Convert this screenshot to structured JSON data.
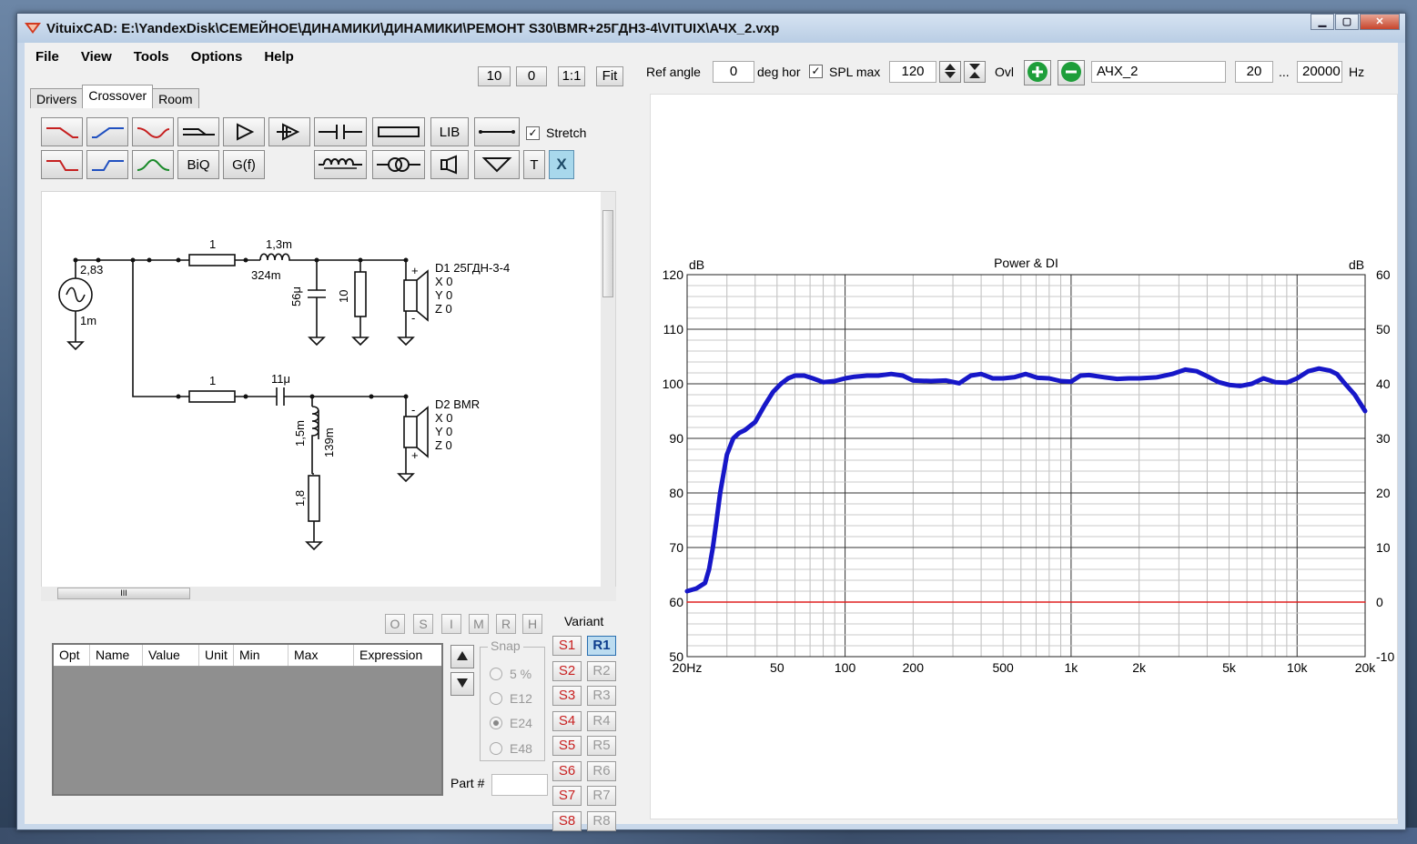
{
  "window": {
    "title": "VituixCAD: E:\\YandexDisk\\СЕМЕЙНОЕ\\ДИНАМИКИ\\ДИНАМИКИ\\РЕМОНТ S30\\BMR+25ГДН3-4\\VITUIX\\АЧХ_2.vxp",
    "controls": [
      "▁",
      "▢",
      "✕"
    ]
  },
  "menu": [
    "File",
    "View",
    "Tools",
    "Options",
    "Help"
  ],
  "left_toolbar": {
    "zoom1": "10",
    "zoom2": "0",
    "one_to_one": "1:1",
    "fit": "Fit"
  },
  "tabs": [
    "Drivers",
    "Crossover",
    "Room"
  ],
  "active_tab": "Crossover",
  "palette": {
    "lib": "LIB",
    "stretch_label": "Stretch",
    "stretch_checked": true,
    "biq": "BiQ",
    "gf": "G(f)",
    "t": "T",
    "x": "X"
  },
  "schematic": {
    "source_voltage": "2,83",
    "source_imp": "1m",
    "r1": "1",
    "l1": "1,3m",
    "l1_r": "324m",
    "c1": "56μ",
    "r_shunt": "10",
    "d1_name": "D1 25ГДН-3-4",
    "d1_xyz": [
      "X 0",
      "Y 0",
      "Z 0"
    ],
    "r2": "1",
    "c2": "11μ",
    "l2": "1,5m",
    "l2_r": "139m",
    "r3": "1,8",
    "d2_name": "D2 BMR",
    "d2_xyz": [
      "X 0",
      "Y 0",
      "Z 0"
    ],
    "plus": "+",
    "minus": "-"
  },
  "scroll_glyph": "III",
  "part_buttons": [
    "O",
    "S",
    "I",
    "M",
    "R",
    "H"
  ],
  "table": {
    "headers": [
      "Opt",
      "Name",
      "Value",
      "Unit",
      "Min",
      "Max",
      "Expression"
    ]
  },
  "snap": {
    "title": "Snap",
    "options": [
      "5 %",
      "E12",
      "E24",
      "E48"
    ],
    "selected": "E24"
  },
  "part_label": "Part #",
  "variant": {
    "title": "Variant",
    "s": [
      "S1",
      "S2",
      "S3",
      "S4",
      "S5",
      "S6",
      "S7",
      "S8"
    ],
    "r": [
      "R1",
      "R2",
      "R3",
      "R4",
      "R5",
      "R6",
      "R7",
      "R8"
    ],
    "selected": "R1"
  },
  "graph_toolbar": {
    "ref_angle_label": "Ref angle",
    "ref_angle": "0",
    "deg_hor": "deg hor",
    "spl_max_label": "SPL max",
    "spl_max_checked": true,
    "spl_max": "120",
    "ovl_label": "Ovl",
    "overlay_name": "АЧХ_2",
    "f_min": "20",
    "dots": "...",
    "f_max": "20000",
    "hz": "Hz"
  },
  "colors": {
    "curve": "#1717c8",
    "di_line": "#e02020",
    "accent_red": "#c82020"
  },
  "chart_data": {
    "type": "line",
    "title": "Power & DI",
    "ylabel_left": "dB",
    "ylabel_right": "dB",
    "x_scale": "log",
    "xlim": [
      20,
      20000
    ],
    "ylim_left": [
      50,
      120
    ],
    "ylim_right": [
      -10,
      60
    ],
    "x_tick_labels": [
      {
        "v": 20,
        "t": "20Hz"
      },
      {
        "v": 50,
        "t": "50"
      },
      {
        "v": 100,
        "t": "100"
      },
      {
        "v": 200,
        "t": "200"
      },
      {
        "v": 500,
        "t": "500"
      },
      {
        "v": 1000,
        "t": "1k"
      },
      {
        "v": 2000,
        "t": "2k"
      },
      {
        "v": 5000,
        "t": "5k"
      },
      {
        "v": 10000,
        "t": "10k"
      },
      {
        "v": 20000,
        "t": "20k"
      }
    ],
    "y_left_ticks": [
      "120",
      "110",
      "100",
      "90",
      "80",
      "70",
      "60",
      "50"
    ],
    "y_right_ticks": [
      "60",
      "50",
      "40",
      "30",
      "20",
      "10",
      "0",
      "-10"
    ],
    "grid": true,
    "series": [
      {
        "axis": "left",
        "color": "#1717c8",
        "x": [
          20,
          22,
          24,
          25,
          26,
          27,
          28,
          30,
          32,
          34,
          36,
          40,
          44,
          48,
          52,
          56,
          60,
          66,
          72,
          80,
          90,
          100,
          110,
          125,
          140,
          160,
          180,
          200,
          240,
          280,
          320,
          360,
          400,
          450,
          500,
          560,
          630,
          710,
          800,
          900,
          1000,
          1100,
          1200,
          1400,
          1600,
          1800,
          2000,
          2400,
          2800,
          3200,
          3600,
          4000,
          4500,
          5000,
          5600,
          6300,
          7100,
          8000,
          9000,
          10000,
          11200,
          12500,
          14000,
          15000,
          16000,
          18000,
          20000
        ],
        "y": [
          62,
          62.5,
          63.5,
          66,
          70,
          75,
          80,
          87,
          90,
          91,
          91.5,
          93,
          96,
          98.5,
          100,
          101,
          101.5,
          101.5,
          101,
          100.3,
          100.5,
          101,
          101.3,
          101.5,
          101.5,
          101.8,
          101.5,
          100.6,
          100.5,
          100.6,
          100.1,
          101.5,
          101.8,
          101,
          101,
          101.2,
          101.8,
          101.1,
          101,
          100.5,
          100.4,
          101.5,
          101.6,
          101.2,
          100.9,
          101,
          101,
          101.2,
          101.8,
          102.6,
          102.3,
          101.4,
          100.3,
          99.8,
          99.6,
          100,
          101,
          100.3,
          100.2,
          101,
          102.3,
          102.8,
          102.4,
          101.8,
          100.4,
          98,
          95
        ]
      },
      {
        "axis": "left",
        "color": "#e02020",
        "x": [
          20,
          20000
        ],
        "y": [
          60,
          60
        ]
      }
    ]
  }
}
